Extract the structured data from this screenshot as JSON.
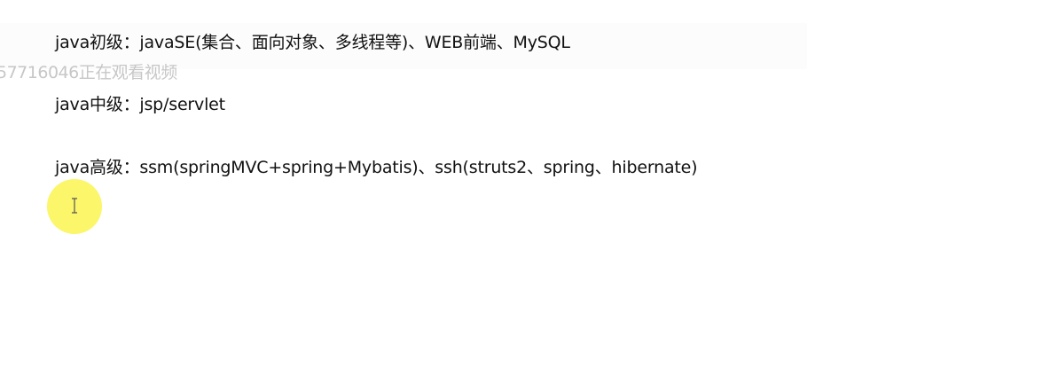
{
  "document": {
    "lines": [
      "java初级：javaSE(集合、面向对象、多线程等)、WEB前端、MySQL",
      "java中级：jsp/servlet",
      "java高级：ssm(springMVC+spring+Mybatis)、ssh(struts2、spring、hibernate)"
    ]
  },
  "overlay": {
    "watermark": "57716046正在观看视频"
  },
  "icons": {
    "cursor": "text-cursor-icon",
    "cursor_highlight_color": "#FAF550"
  }
}
